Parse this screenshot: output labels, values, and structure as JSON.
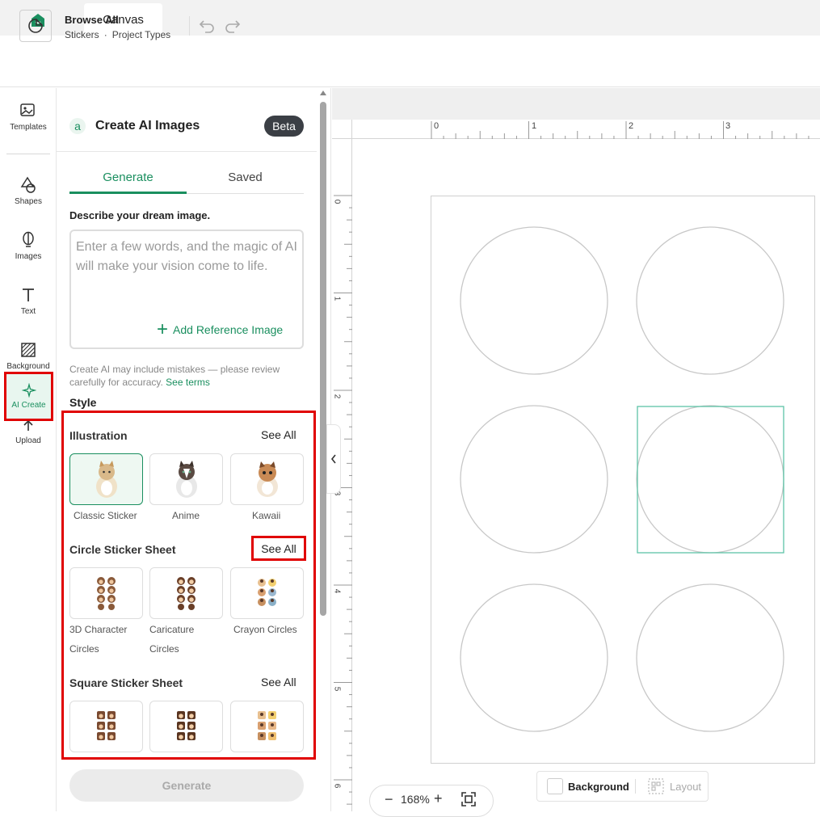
{
  "tabs": {
    "active": "Canvas"
  },
  "header": {
    "title": "Browse All",
    "crumb1": "Stickers",
    "separator": "·",
    "crumb2": "Project Types"
  },
  "rail": {
    "templates": "Templates",
    "shapes": "Shapes",
    "images": "Images",
    "text": "Text",
    "background": "Background",
    "upload": "Upload",
    "ai_create": "AI Create"
  },
  "panel": {
    "title": "Create AI Images",
    "badge": "Beta",
    "logo_letter": "a",
    "tabs": {
      "generate": "Generate",
      "saved": "Saved"
    },
    "describe_label": "Describe your dream image.",
    "prompt_placeholder": "Enter a few words, and the magic of AI will make your vision come to life.",
    "add_reference": "Add Reference Image",
    "disclaimer": "Create AI may include mistakes — please review carefully for accuracy.",
    "terms_link": "See terms",
    "style_label": "Style",
    "generate_button": "Generate"
  },
  "styles": {
    "illustration": {
      "title": "Illustration",
      "see_all": "See All",
      "items": [
        "Classic Sticker",
        "Anime",
        "Kawaii"
      ]
    },
    "circle_sheet": {
      "title": "Circle Sticker Sheet",
      "see_all": "See All",
      "items": [
        [
          "3D Character",
          "Circles"
        ],
        [
          "Caricature",
          "Circles"
        ],
        [
          "Crayon Circles",
          ""
        ]
      ]
    },
    "square_sheet": {
      "title": "Square Sticker Sheet",
      "see_all": "See All"
    }
  },
  "rulers": {
    "top": [
      "0",
      "1",
      "2",
      "3"
    ],
    "left": [
      "0",
      "1",
      "2",
      "3",
      "4",
      "5",
      "6"
    ]
  },
  "zoom": {
    "minus": "−",
    "value": "168%",
    "plus": "+"
  },
  "footer": {
    "background": "Background",
    "layout": "Layout"
  },
  "colors": {
    "accent": "#1a8f5f",
    "highlight": "#e00000",
    "selection": "#5ec4a7"
  }
}
